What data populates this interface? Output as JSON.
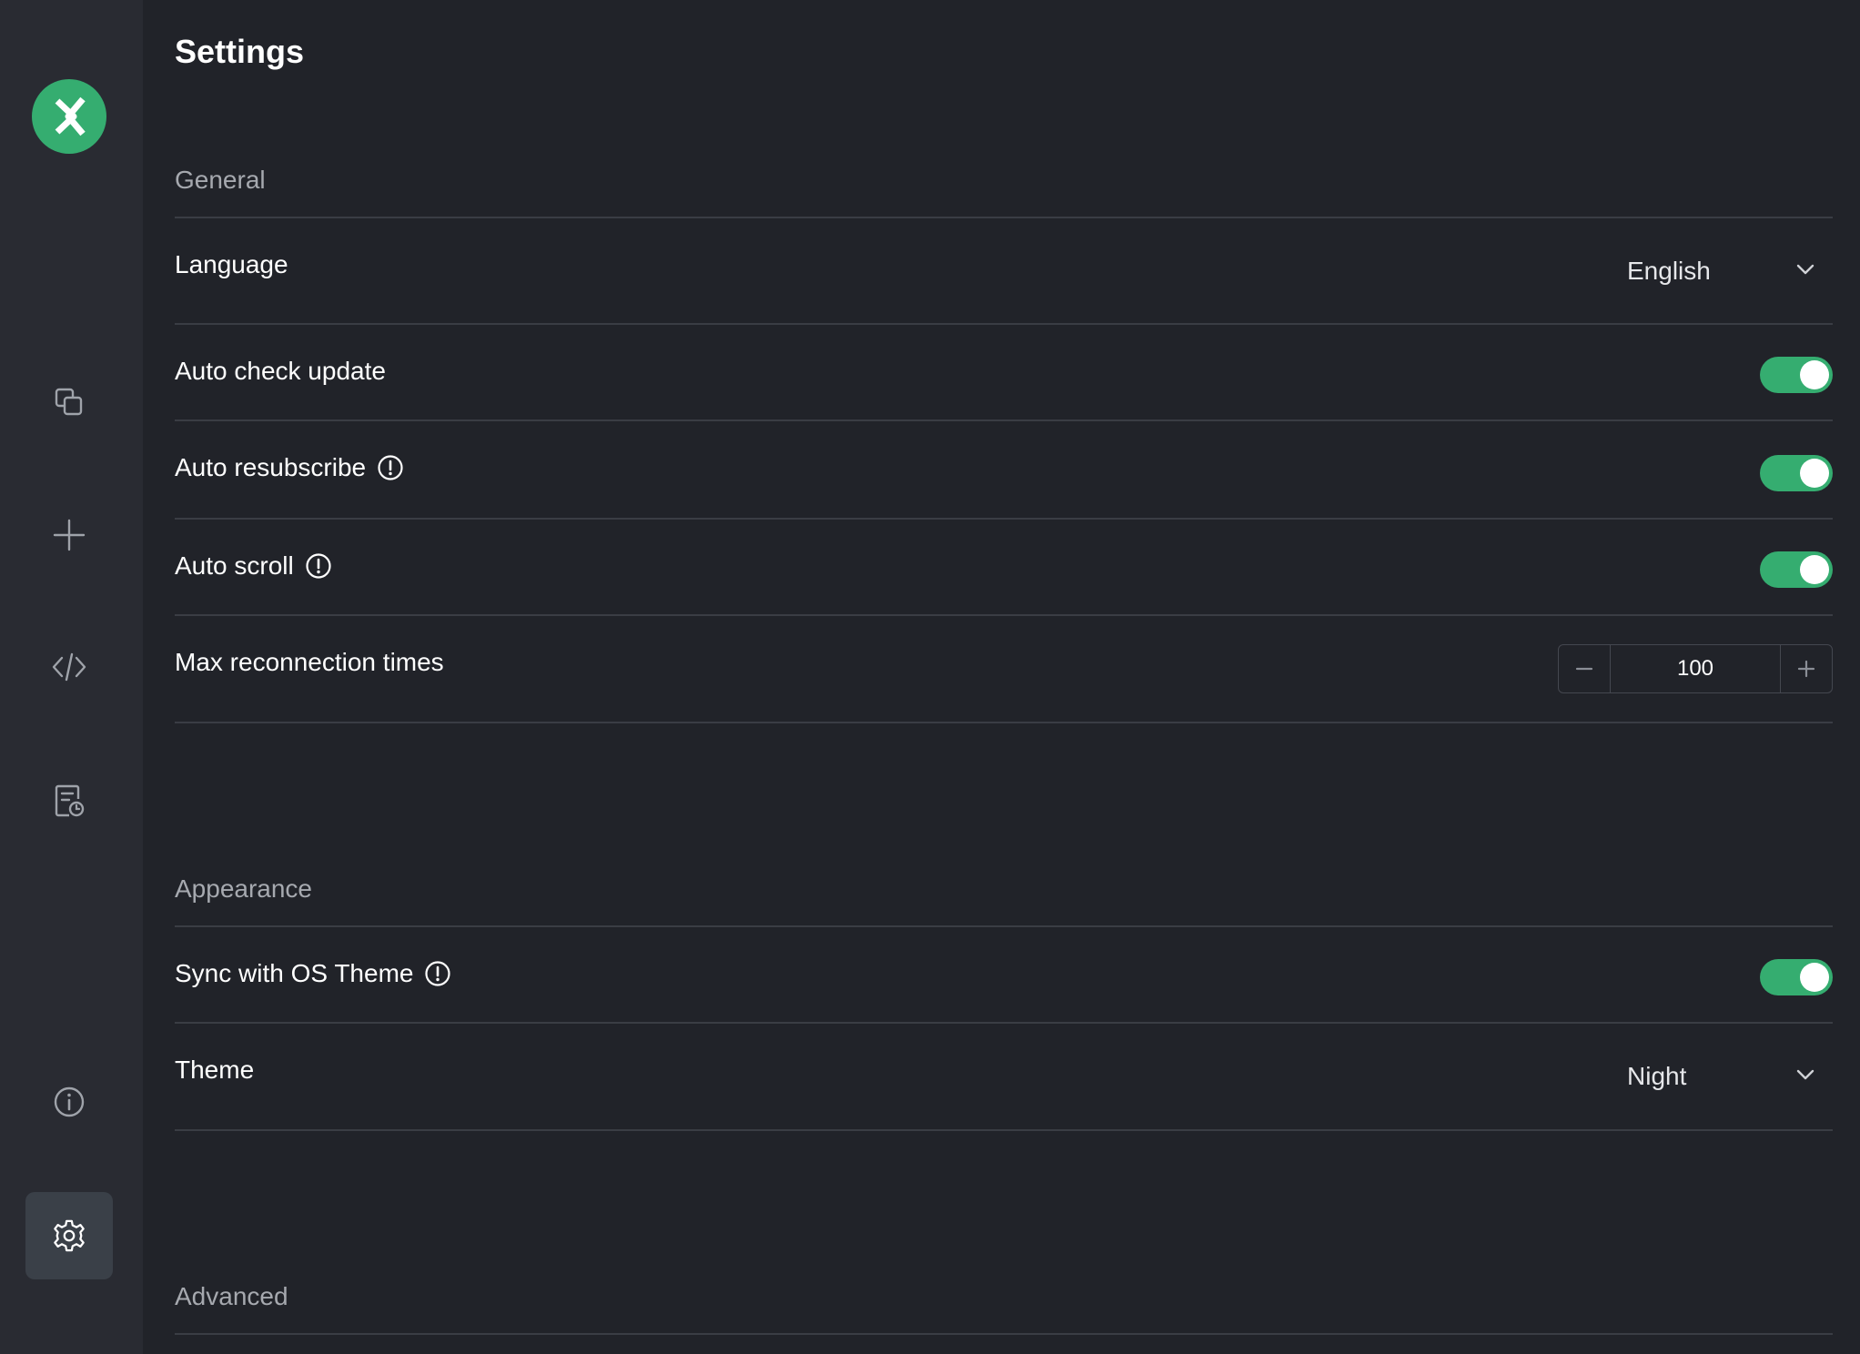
{
  "page": {
    "title": "Settings"
  },
  "sections": {
    "general": {
      "title": "General",
      "language": {
        "label": "Language",
        "value": "English"
      },
      "auto_check_update": {
        "label": "Auto check update",
        "enabled": true
      },
      "auto_resubscribe": {
        "label": "Auto resubscribe",
        "enabled": true
      },
      "auto_scroll": {
        "label": "Auto scroll",
        "enabled": true
      },
      "max_reconnection": {
        "label": "Max reconnection times",
        "value": "100"
      }
    },
    "appearance": {
      "title": "Appearance",
      "sync_os_theme": {
        "label": "Sync with OS Theme",
        "enabled": true
      },
      "theme": {
        "label": "Theme",
        "value": "Night"
      }
    },
    "advanced": {
      "title": "Advanced"
    }
  },
  "sidebar": {
    "items": [
      {
        "icon": "connections-icon"
      },
      {
        "icon": "plus-icon"
      },
      {
        "icon": "code-icon"
      },
      {
        "icon": "log-icon"
      },
      {
        "icon": "info-icon"
      },
      {
        "icon": "gear-icon",
        "active": true
      }
    ]
  },
  "colors": {
    "accent": "#35ad70",
    "background": "#212329",
    "sidebar": "#292b32",
    "divider": "#3a3d44",
    "muted_text": "#a6a9af"
  }
}
